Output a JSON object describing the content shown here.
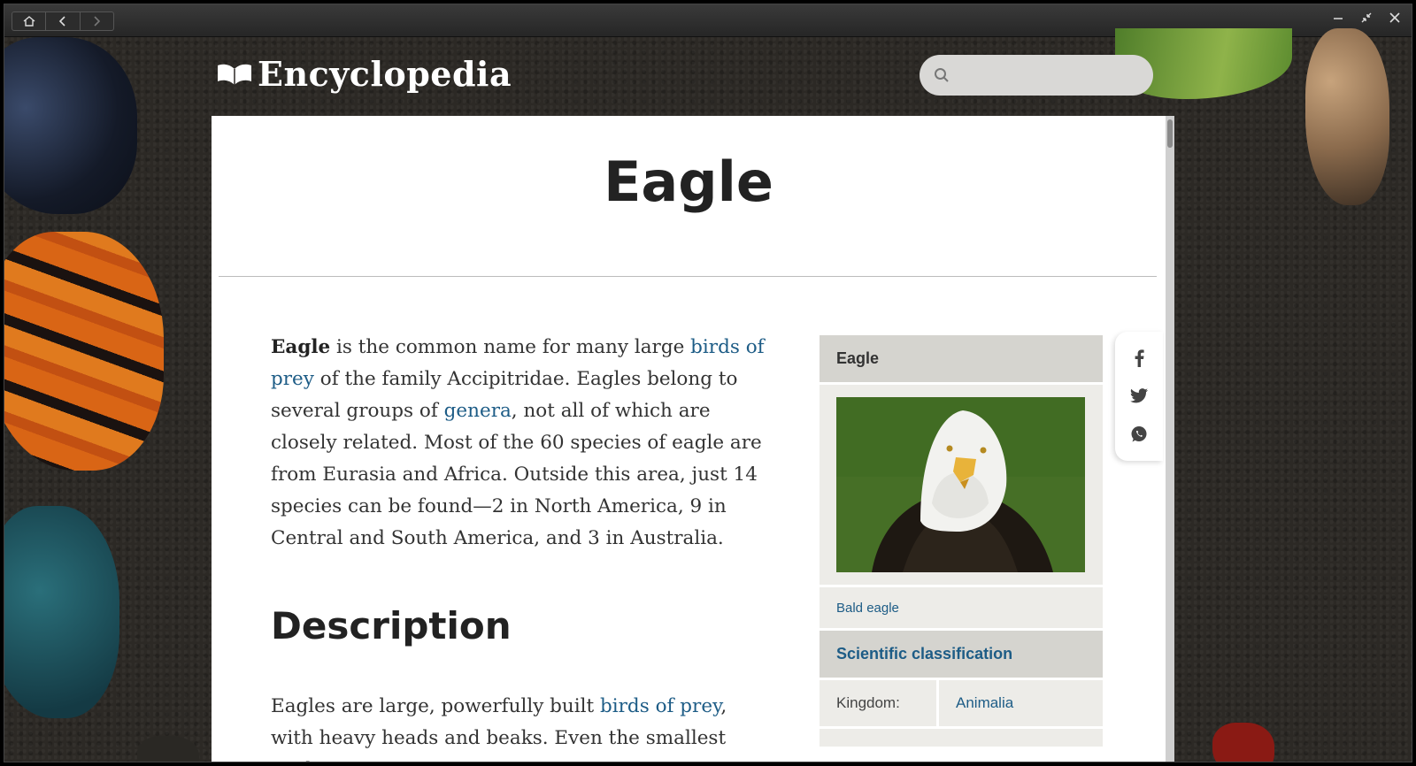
{
  "titlebar": {
    "home_icon": "home-icon",
    "back_icon": "chevron-left-icon",
    "forward_icon": "chevron-right-icon",
    "controls": [
      "minimize-icon",
      "restore-icon",
      "close-icon"
    ]
  },
  "header": {
    "logo_text": "Encyclopedia",
    "logo_icon": "open-book-icon",
    "search": {
      "placeholder": "",
      "value": "",
      "icon": "search-icon"
    }
  },
  "article": {
    "title": "Eagle",
    "lead": {
      "bold": "Eagle",
      "t1": " is the common name for many large ",
      "link1": "birds of prey",
      "t2": " of the family Accipitridae. Eagles belong to several groups of ",
      "link2": "genera",
      "t3": ", not all of which are closely related. Most of the 60 species of eagle are from Eurasia and Africa. Outside this area, just 14 species can be found—2 in North America, 9 in Central and South America, and 3 in Australia."
    },
    "description_heading": "Description",
    "description": {
      "t1": "Eagles are large, powerfully built ",
      "link1": "birds of prey",
      "t2": ", with heavy heads and beaks. Even the smallest eagles,"
    }
  },
  "infobox": {
    "title": "Eagle",
    "image_caption": "Bald eagle",
    "classification_heading": "Scientific classification",
    "kingdom_label": "Kingdom:",
    "kingdom_value": "Animalia"
  },
  "share": {
    "icons": [
      "facebook-icon",
      "twitter-icon",
      "whatsapp-icon"
    ]
  },
  "colors": {
    "link": "#1d5c86",
    "infobox_header": "#d5d4cf",
    "infobox_body": "#edece8",
    "background": "#2c2925"
  }
}
